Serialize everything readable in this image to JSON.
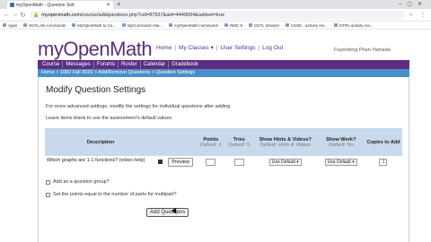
{
  "browser": {
    "tab_title": "myOpenMath - Question Sett",
    "url_host": "myopenmath.com",
    "url_path": "/course/addquestions.php?cid=87937&aid=4449694&addset=true",
    "bookmarks": [
      "Apps",
      "MATLAB commands",
      "MyOpenMath to Ca...",
      "MyCurriculum Ma...",
      "myOpenMath homework",
      "RMC 8",
      "CETL Intranet",
      "CSSE - activity rev...",
      "GTRs activity rev..."
    ]
  },
  "site": {
    "logo_prefix": "my",
    "logo_main": "OpenMath",
    "top_nav": {
      "home": "Home",
      "my_classes": "My Classes ▾",
      "user_settings": "User Settings",
      "logout": "Log Out"
    },
    "username": "Fuyerdong Phan-Yamada",
    "main_nav": [
      "Course",
      "Messages",
      "Forums",
      "Roster",
      "Calendar",
      "Gradebook"
    ],
    "breadcrumb": "Home > 1082 Fall 2020 > Add/Remove Questions > Question Settings"
  },
  "main": {
    "heading": "Modify Question Settings",
    "intro": "For more advanced settings, modify the settings for individual questions after adding",
    "note": "Leave items blank to use the assessment's default values",
    "table": {
      "headers": {
        "description": "Description",
        "points": "Points",
        "points_default": "Default: 1",
        "tries": "Tries",
        "tries_default": "Default: 5",
        "hints": "Show Hints & Videos?",
        "hints_default": "Default: Hints & Videos",
        "work": "Show Work?",
        "work_default": "Default: No",
        "copies": "Copies to Add"
      },
      "row": {
        "description": "Which graphs are 1-1 functions? (video help)",
        "preview": "Preview",
        "hints_value": "Use Default ▾",
        "work_value": "Use Default ▾",
        "copies_value": "1"
      }
    },
    "checkbox_group": "Add as a question group?",
    "checkbox_points": "Set the points equal to the number of parts for multipart?",
    "add_button": "Add Questions"
  }
}
